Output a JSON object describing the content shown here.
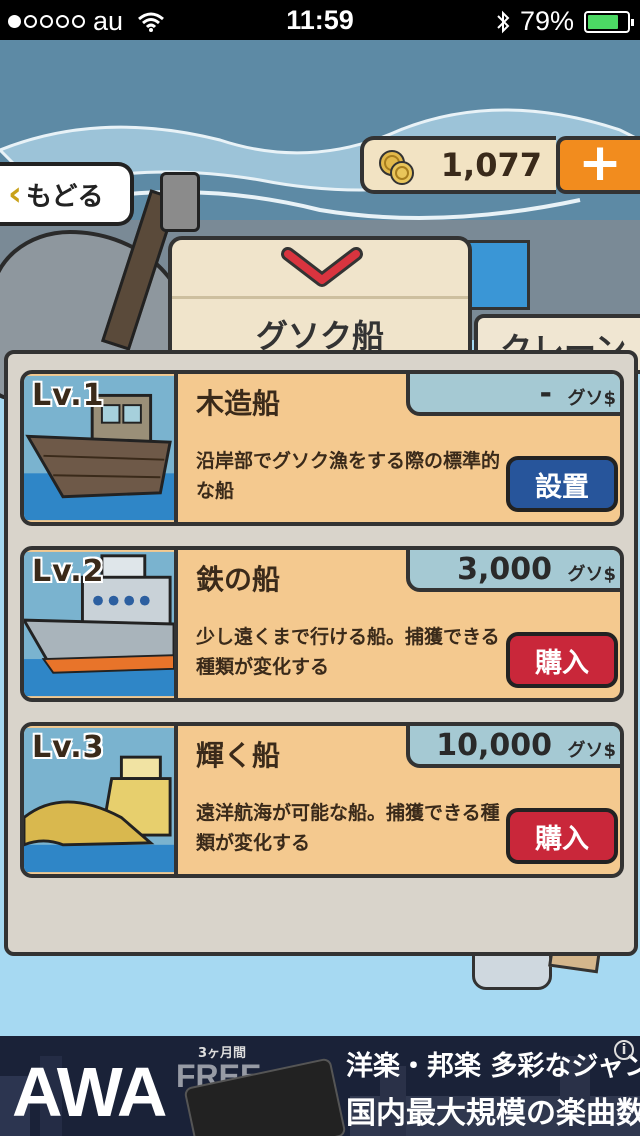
{
  "status_bar": {
    "carrier": "au",
    "time": "11:59",
    "battery_percent": "79%",
    "battery_level": 0.79,
    "signal_bars_filled": 1,
    "signal_bars_total": 5
  },
  "nav": {
    "back_label": "もどる"
  },
  "currency": {
    "coins": "1,077",
    "add_label": "+"
  },
  "panel": {
    "title": "グソク船",
    "side_tab": "クレーン"
  },
  "items": [
    {
      "level": "Lv.1",
      "name": "木造船",
      "price": "-",
      "currency": "グソ$",
      "description": "沿岸部でグソク漁をする際の標準的な船",
      "button": "設置",
      "button_color": "#27559b"
    },
    {
      "level": "Lv.2",
      "name": "鉄の船",
      "price": "3,000",
      "currency": "グソ$",
      "description": "少し遠くまで行ける船。捕獲できる種類が変化する",
      "button": "購入",
      "button_color": "#c9273a"
    },
    {
      "level": "Lv.3",
      "name": "輝く船",
      "price": "10,000",
      "currency": "グソ$",
      "description": "遠洋航海が可能な船。捕獲できる種類が変化する",
      "button": "購入",
      "button_color": "#c9273a"
    }
  ],
  "ad": {
    "logo": "AWA",
    "months": "3ヶ月間",
    "free": "FREE",
    "line1": "洋楽・邦楽 多彩なジャンルで",
    "line2": "国内最大規模の楽曲数",
    "info": "i"
  }
}
